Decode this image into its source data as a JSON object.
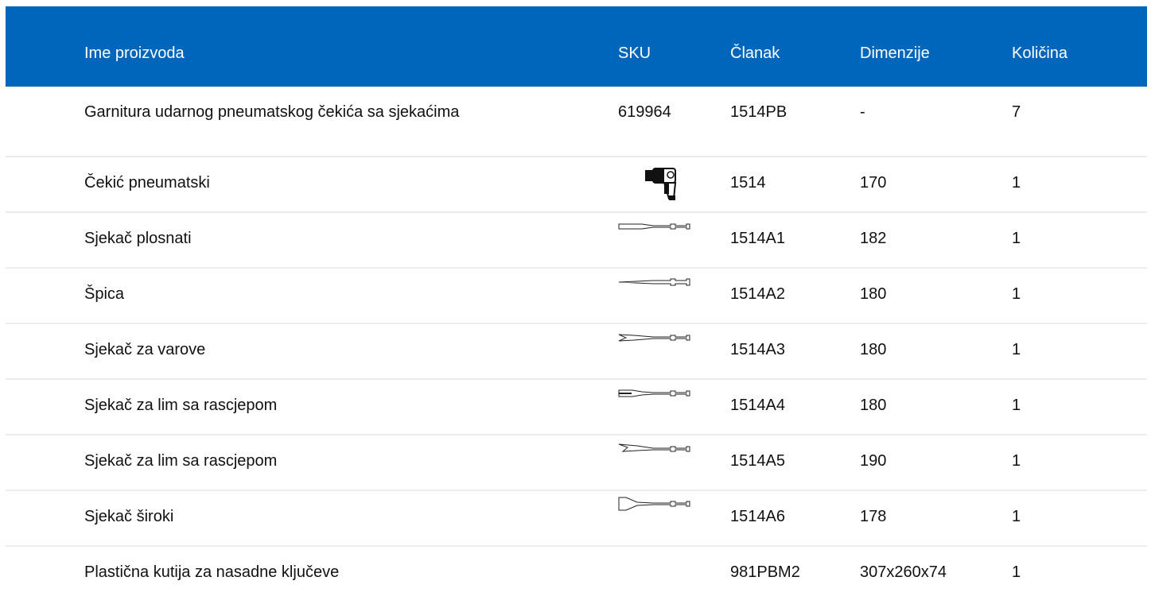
{
  "table": {
    "header": {
      "name": "Ime proizvoda",
      "sku": "SKU",
      "article": "Članak",
      "dimensions": "Dimenzije",
      "quantity": "Količina"
    },
    "rows": [
      {
        "name": "Garnitura udarnog pneumatskog čekića sa sjekaćima",
        "sku": "619964",
        "article": "1514PB",
        "dimensions": "-",
        "quantity": "7"
      },
      {
        "name": "Čekić pneumatski",
        "sku_icon": "air-hammer-icon",
        "article": "1514",
        "dimensions": "170",
        "quantity": "1"
      },
      {
        "name": "Sjekač plosnati",
        "sku_icon": "flat-chisel-icon",
        "article": "1514A1",
        "dimensions": "182",
        "quantity": "1"
      },
      {
        "name": "Špica",
        "sku_icon": "point-chisel-icon",
        "article": "1514A2",
        "dimensions": "180",
        "quantity": "1"
      },
      {
        "name": "Sjekač za varove",
        "sku_icon": "weld-chisel-icon",
        "article": "1514A3",
        "dimensions": "180",
        "quantity": "1"
      },
      {
        "name": "Sjekač za lim sa rascjepom",
        "sku_icon": "slotted-sheet-chisel-icon",
        "article": "1514A4",
        "dimensions": "180",
        "quantity": "1"
      },
      {
        "name": "Sjekač za lim sa rascjepom",
        "sku_icon": "angled-sheet-chisel-icon",
        "article": "1514A5",
        "dimensions": "190",
        "quantity": "1"
      },
      {
        "name": "Sjekač široki",
        "sku_icon": "wide-chisel-icon",
        "article": "1514A6",
        "dimensions": "178",
        "quantity": "1"
      },
      {
        "name": "Plastična kutija za nasadne ključeve",
        "sku_icon": "",
        "article": "981PBM2",
        "dimensions": "307x260x74",
        "quantity": "1"
      }
    ]
  }
}
